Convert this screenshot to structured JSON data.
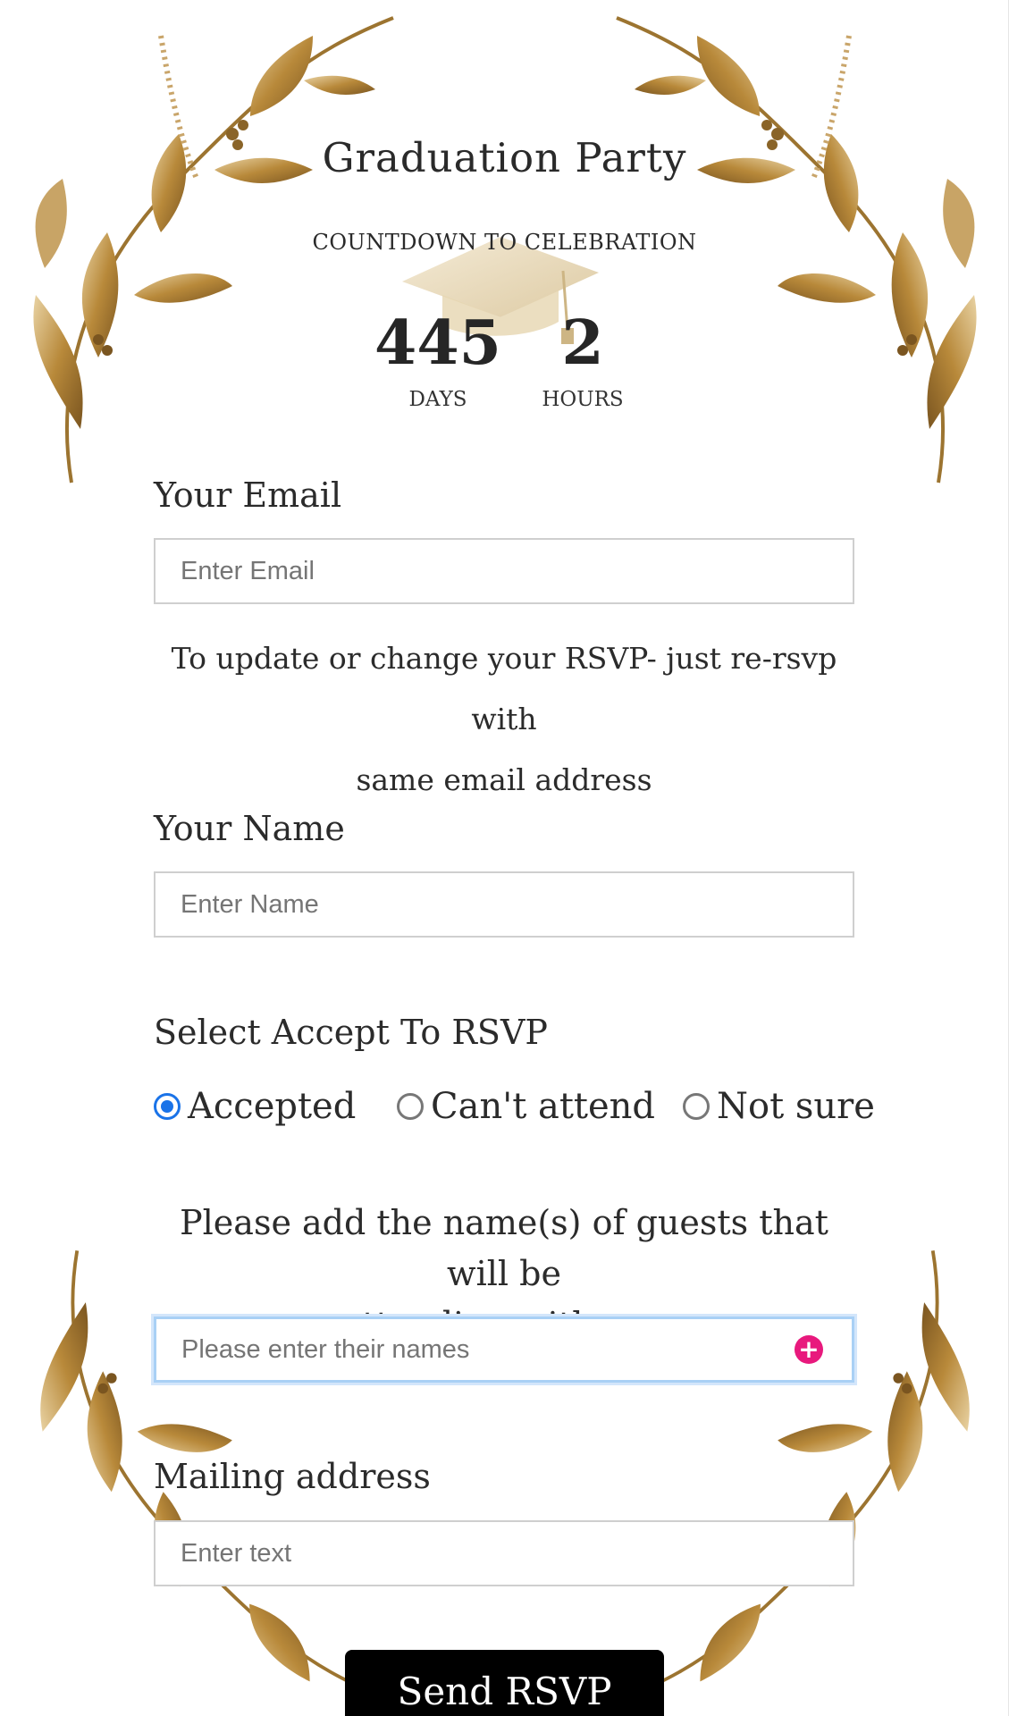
{
  "event": {
    "title": "Graduation Party",
    "subtitle": "COUNTDOWN TO CELEBRATION"
  },
  "countdown": {
    "days_value": "445",
    "days_label": "DAYS",
    "hours_value": "2",
    "hours_label": "HOURS"
  },
  "form": {
    "email_label": "Your Email",
    "email_placeholder": "Enter Email",
    "email_help_line1": "To update or change your RSVP- just re-rsvp with",
    "email_help_line2": "same email address",
    "name_label": "Your Name",
    "name_placeholder": "Enter Name",
    "rsvp_label": "Select Accept To RSVP",
    "rsvp_options": [
      {
        "label": "Accepted",
        "selected": true
      },
      {
        "label": "Can't attend",
        "selected": false
      },
      {
        "label": "Not sure",
        "selected": false
      }
    ],
    "guests_prompt_line1": "Please add the name(s) of guests that will be",
    "guests_prompt_line2": "attending with you",
    "guests_placeholder": "Please enter their names",
    "address_label": "Mailing address",
    "address_placeholder": "Enter text",
    "submit_label": "Send RSVP"
  },
  "colors": {
    "accent_blue": "#1a73e8",
    "add_button_pink": "#e8197d",
    "gold": "#b8893a",
    "submit_bg": "#000000"
  },
  "icons": {
    "add": "plus-circle-icon",
    "decoration": "gold-leaf-foliage",
    "cap": "graduation-cap-icon"
  }
}
